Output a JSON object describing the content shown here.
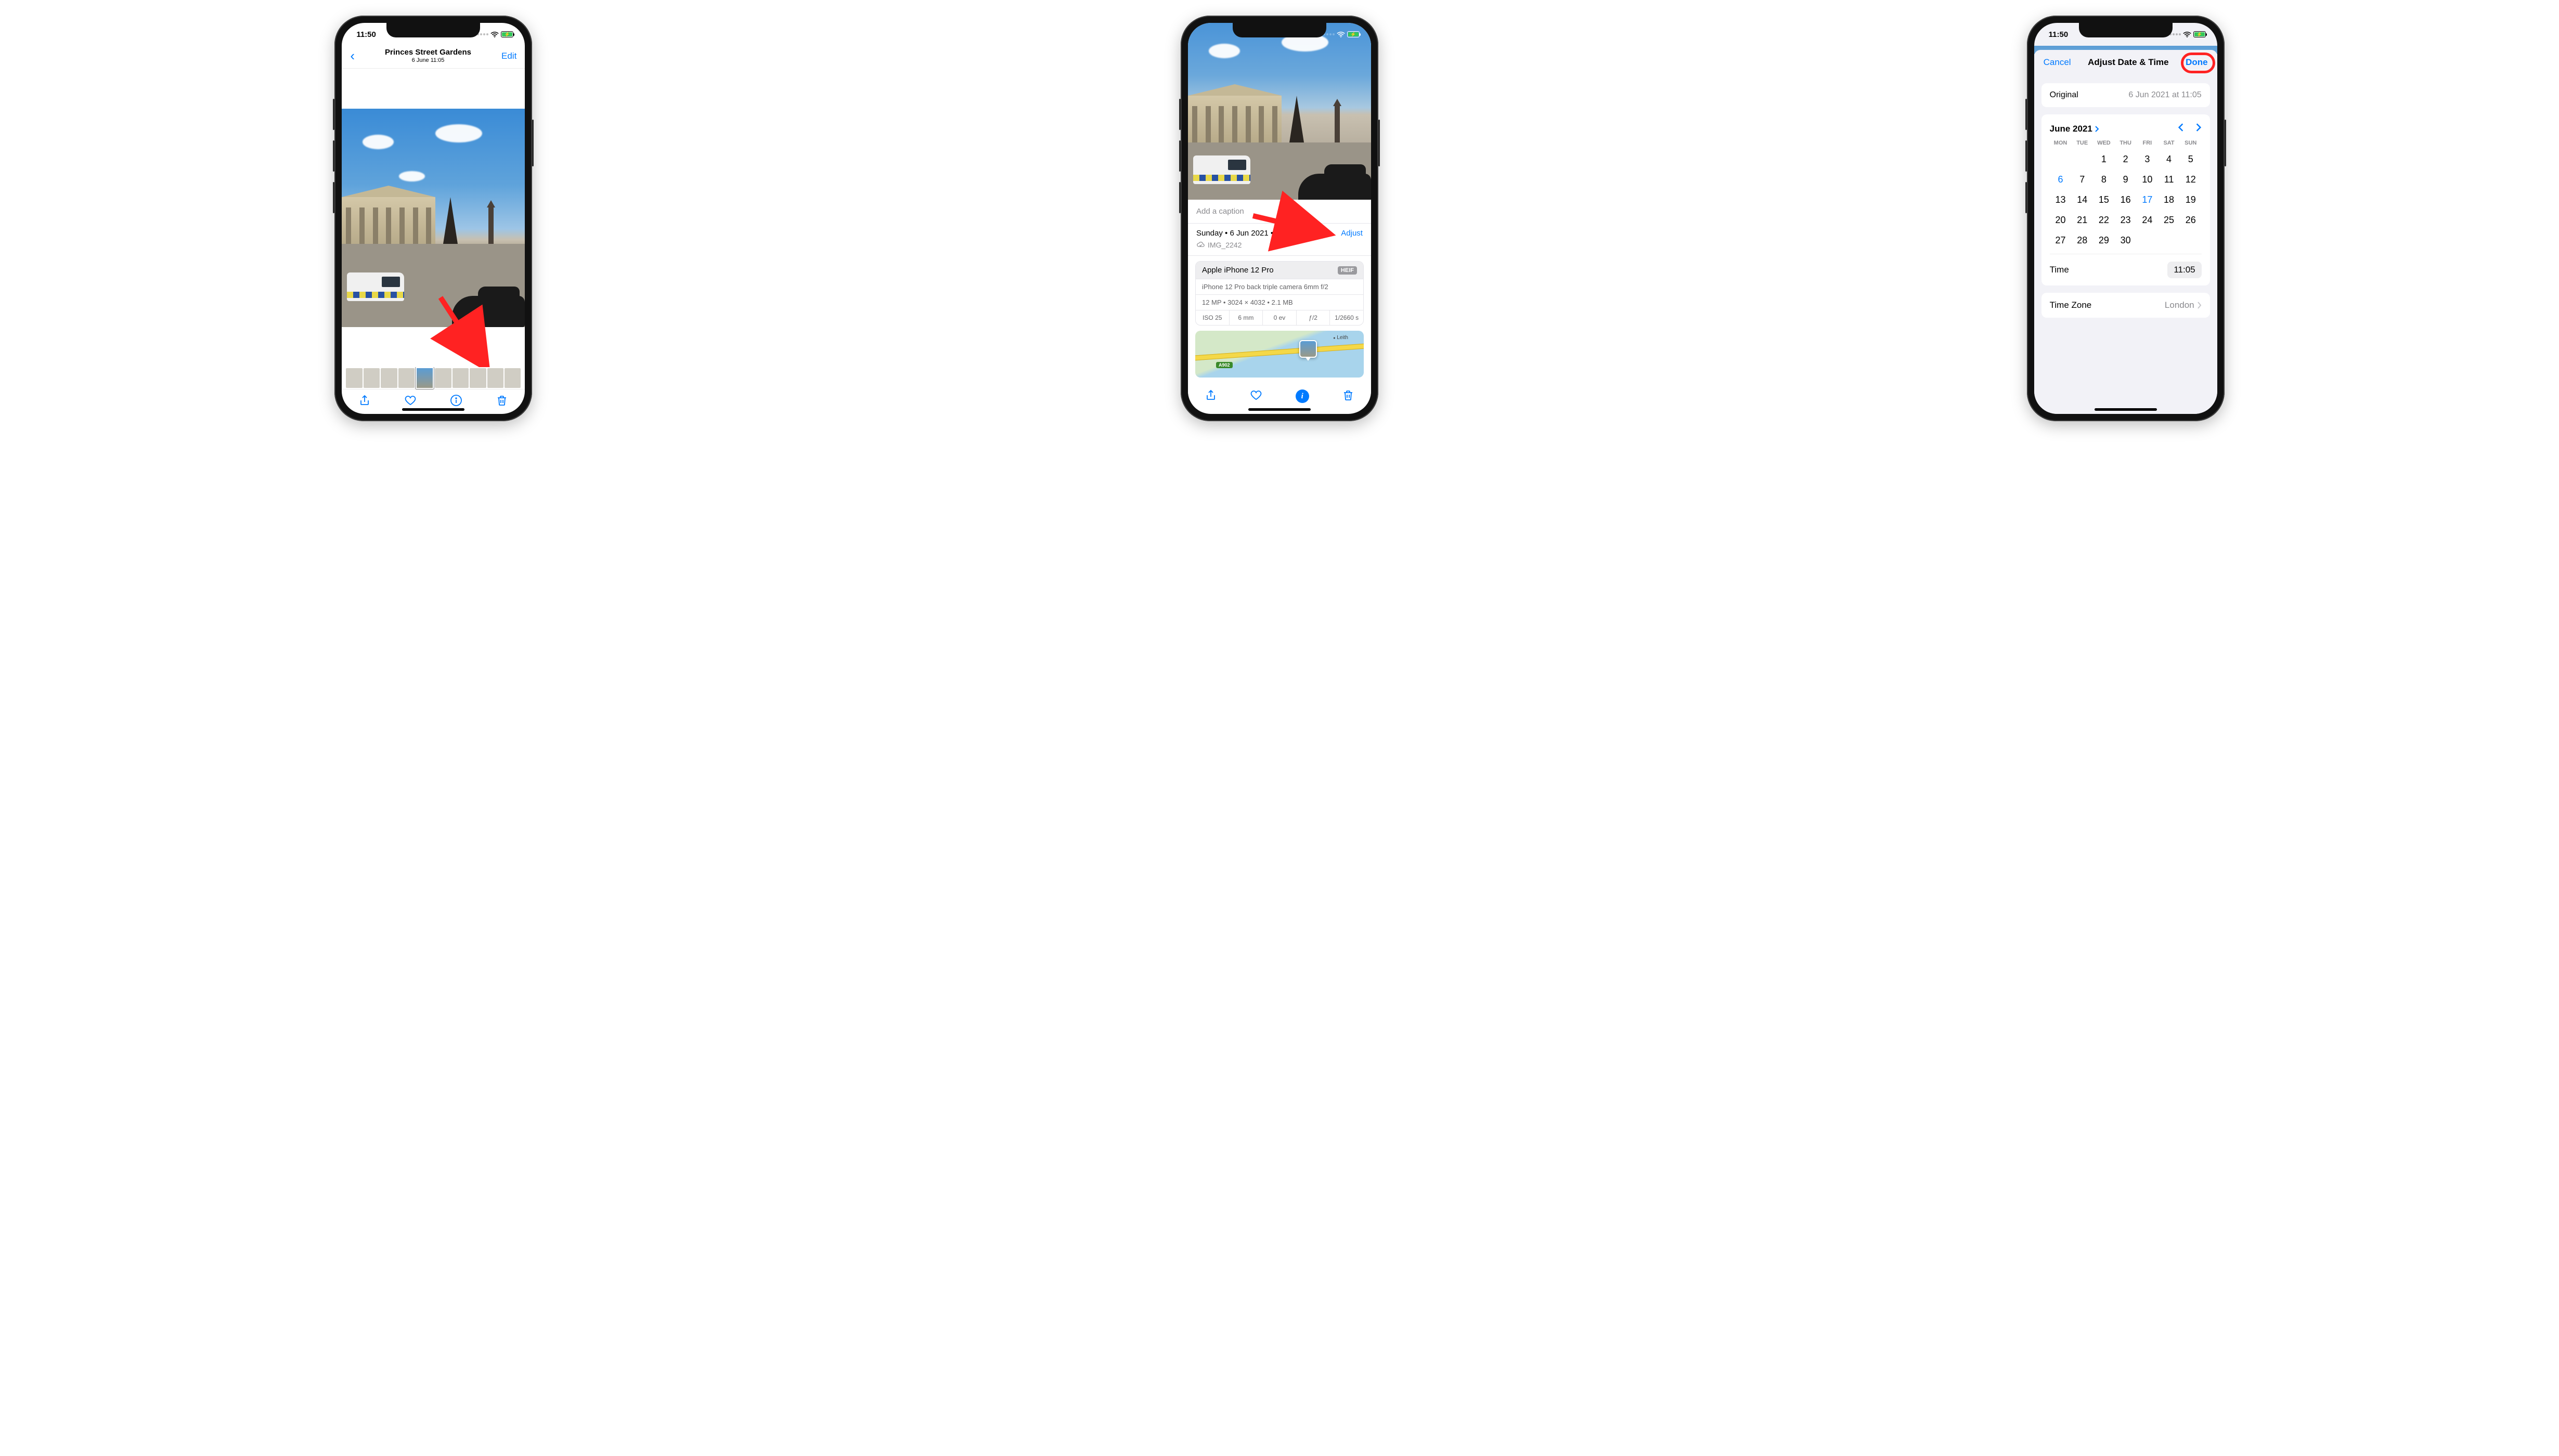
{
  "status": {
    "time": "11:50"
  },
  "phone1": {
    "nav": {
      "title": "Princes Street Gardens",
      "subtitle": "6 June  11:05",
      "edit": "Edit"
    }
  },
  "phone2": {
    "caption_placeholder": "Add a caption",
    "date_line": "Sunday  •  6 Jun 2021  •  11:05",
    "adjust": "Adjust",
    "filename": "IMG_2242",
    "camera": {
      "device": "Apple iPhone 12 Pro",
      "format": "HEIF",
      "lens": "iPhone 12 Pro back triple camera 6mm f/2",
      "meta": "12 MP  •  3024 × 4032  •  2.1 MB",
      "specs": [
        "ISO 25",
        "6 mm",
        "0 ev",
        "ƒ/2",
        "1/2660 s"
      ]
    },
    "map": {
      "label": "Leith",
      "road": "A902"
    }
  },
  "phone3": {
    "cancel": "Cancel",
    "title": "Adjust Date & Time",
    "done": "Done",
    "original_label": "Original",
    "original_value": "6 Jun 2021 at 11:05",
    "month": "June 2021",
    "dow": [
      "MON",
      "TUE",
      "WED",
      "THU",
      "FRI",
      "SAT",
      "SUN"
    ],
    "days": [
      "",
      "",
      "1",
      "2",
      "3",
      "4",
      "5",
      "6",
      "7",
      "8",
      "9",
      "10",
      "11",
      "12",
      "13",
      "14",
      "15",
      "16",
      "17",
      "18",
      "19",
      "20",
      "21",
      "22",
      "23",
      "24",
      "25",
      "26",
      "27",
      "28",
      "29",
      "30"
    ],
    "selected_day": "6",
    "today": "17",
    "time_label": "Time",
    "time_value": "11:05",
    "tz_label": "Time Zone",
    "tz_value": "London"
  }
}
